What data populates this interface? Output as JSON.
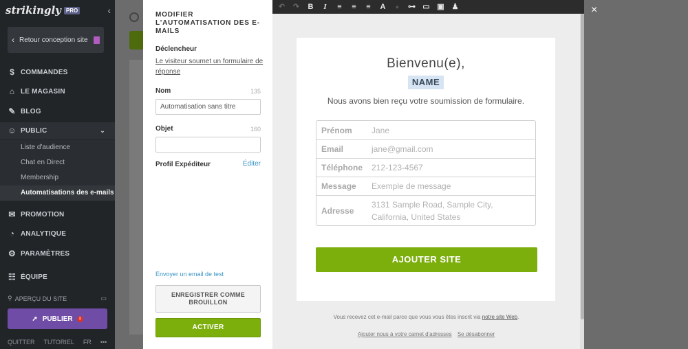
{
  "sidebar": {
    "logo": "strikingly",
    "badge": "PRO",
    "back_label": "Retour conception site",
    "nav": [
      {
        "label": "COMMANDES",
        "icon": "dollar-icon"
      },
      {
        "label": "LE MAGASIN",
        "icon": "store-icon"
      },
      {
        "label": "BLOG",
        "icon": "pen-icon"
      },
      {
        "label": "PUBLIC",
        "icon": "people-icon"
      },
      {
        "label": "PROMOTION",
        "icon": "megaphone-icon"
      },
      {
        "label": "ANALYTIQUE",
        "icon": "chart-icon"
      },
      {
        "label": "PARAMÈTRES",
        "icon": "gear-icon"
      },
      {
        "label": "ÉQUIPE",
        "icon": "team-icon"
      }
    ],
    "public_sub": [
      "Liste d'audience",
      "Chat en Direct",
      "Membership",
      "Automatisations des e-mails"
    ],
    "preview_label": "APERÇU DU SITE",
    "publish_label": "PUBLIER",
    "footer": [
      "QUITTER",
      "TUTORIEL",
      "FR",
      "•••"
    ]
  },
  "settings": {
    "title": "MODIFIER L'AUTOMATISATION DES E-MAILS",
    "trigger_label": "Déclencheur",
    "trigger_value": "Le visiteur soumet un formulaire de réponse",
    "name_label": "Nom",
    "name_count": "135",
    "name_value": "Automatisation sans titre",
    "subject_label": "Objet",
    "subject_count": "160",
    "subject_value": "",
    "sender_label": "Profil Expéditeur",
    "edit_label": "Éditer",
    "test_link": "Envoyer un email de test",
    "draft_button": "ENREGISTRER COMME BROUILLON",
    "activate_button": "ACTIVER"
  },
  "toolbar": {
    "undo": "↶",
    "redo": "↷",
    "bold": "B",
    "italic": "I",
    "text_color": "A"
  },
  "email": {
    "greeting": "Bienvenu(e),",
    "name_tag": "NAME",
    "received": "Nous avons bien reçu votre soumission de formulaire.",
    "fields": [
      {
        "label": "Prénom",
        "value": "Jane"
      },
      {
        "label": "Email",
        "value": "jane@gmail.com"
      },
      {
        "label": "Téléphone",
        "value": "212-123-4567"
      },
      {
        "label": "Message",
        "value": "Exemple de message"
      },
      {
        "label": "Adresse",
        "value": "3131 Sample Road, Sample City, California, United States"
      }
    ],
    "cta": "AJOUTER SITE",
    "footer_text": "Vous recevez cet e-mail parce que vous vous êtes inscrit via",
    "footer_link": "notre site Web",
    "footer_link2": "Ajouter nous à votre carnet d'adresses",
    "footer_link3": "Se désabonner"
  },
  "colors": {
    "accent_green": "#7cae0c",
    "publish_purple": "#6f4ca6",
    "link_blue": "#3a94c4",
    "sidebar_bg": "#222528"
  },
  "close": "×"
}
